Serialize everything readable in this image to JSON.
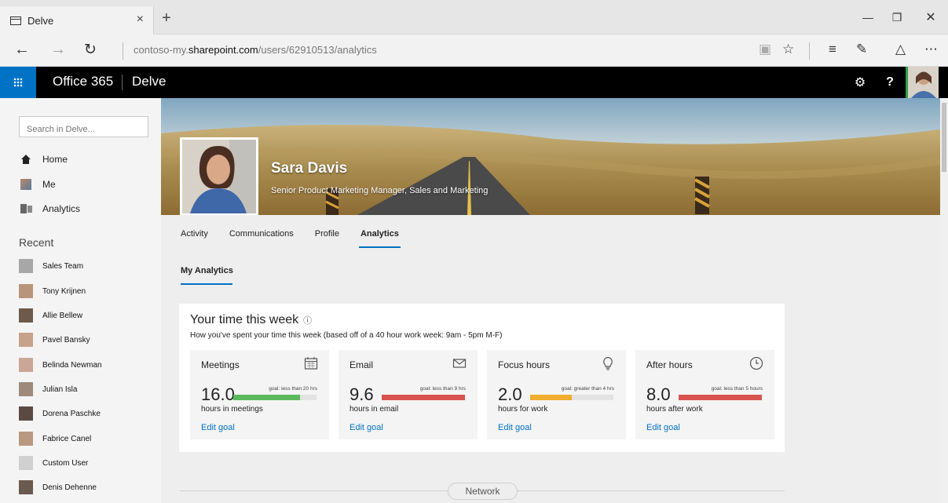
{
  "browser": {
    "tab_title": "Delve",
    "tab_close": "×",
    "new_tab": "+",
    "url_prefix": "contoso-my.",
    "url_domain": "sharepoint.com",
    "url_path": "/users/62910513/analytics",
    "icons": [
      "tab-page-icon",
      "back-icon",
      "forward-icon",
      "refresh-icon",
      "reading-view-icon",
      "favorite-star-icon",
      "hub-icon",
      "web-note-icon",
      "share-icon",
      "more-icon",
      "minimize-icon",
      "restore-icon",
      "close-icon"
    ]
  },
  "suite": {
    "brand": "Office 365",
    "app": "Delve",
    "help": "?"
  },
  "sidebar": {
    "search_placeholder": "Search in Delve...",
    "nav": [
      {
        "label": "Home",
        "icon": "home-icon"
      },
      {
        "label": "Me",
        "icon": "person-icon"
      },
      {
        "label": "Analytics",
        "icon": "analytics-icon"
      }
    ],
    "recent_heading": "Recent",
    "recent": [
      {
        "label": "Sales Team"
      },
      {
        "label": "Tony Krijnen"
      },
      {
        "label": "Allie Bellew"
      },
      {
        "label": "Pavel Bansky"
      },
      {
        "label": "Belinda Newman"
      },
      {
        "label": "Julian Isla"
      },
      {
        "label": "Dorena Paschke"
      },
      {
        "label": "Fabrice Canel"
      },
      {
        "label": "Custom User"
      },
      {
        "label": "Denis Dehenne"
      }
    ]
  },
  "profile": {
    "name": "Sara Davis",
    "title": "Senior Product Marketing Manager, Sales and Marketing"
  },
  "tabs": [
    "Activity",
    "Communications",
    "Profile",
    "Analytics"
  ],
  "active_tab": "Analytics",
  "subtab": "My Analytics",
  "card": {
    "title": "Your time this week",
    "info_icon": "ⓘ",
    "subtitle": "How you've spent your time this week (based off of a 40 hour work week: 9am - 5pm M-F)",
    "tiles": [
      {
        "name": "Meetings",
        "icon": "calendar-icon",
        "value": "16.0",
        "goal": "goal: less than 20 hrs",
        "unit": "hours in meetings",
        "edit": "Edit goal",
        "fill": 0.8,
        "color": "#5cb85c"
      },
      {
        "name": "Email",
        "icon": "envelope-icon",
        "value": "9.6",
        "goal": "goal: less than 9 hrs",
        "unit": "hours in email",
        "edit": "Edit goal",
        "fill": 1.0,
        "color": "#d9534f"
      },
      {
        "name": "Focus hours",
        "icon": "lightbulb-icon",
        "value": "2.0",
        "goal": "goal: greater than 4 hrs",
        "unit": "hours for work",
        "edit": "Edit goal",
        "fill": 0.5,
        "color": "#f0ad2e"
      },
      {
        "name": "After hours",
        "icon": "clock-icon",
        "value": "8.0",
        "goal": "goal: less than 5 hours",
        "unit": "hours after work",
        "edit": "Edit goal",
        "fill": 1.0,
        "color": "#d9534f"
      }
    ]
  },
  "network_label": "Network",
  "colors": {
    "accent": "#0072c6",
    "suitebar": "#000000"
  }
}
